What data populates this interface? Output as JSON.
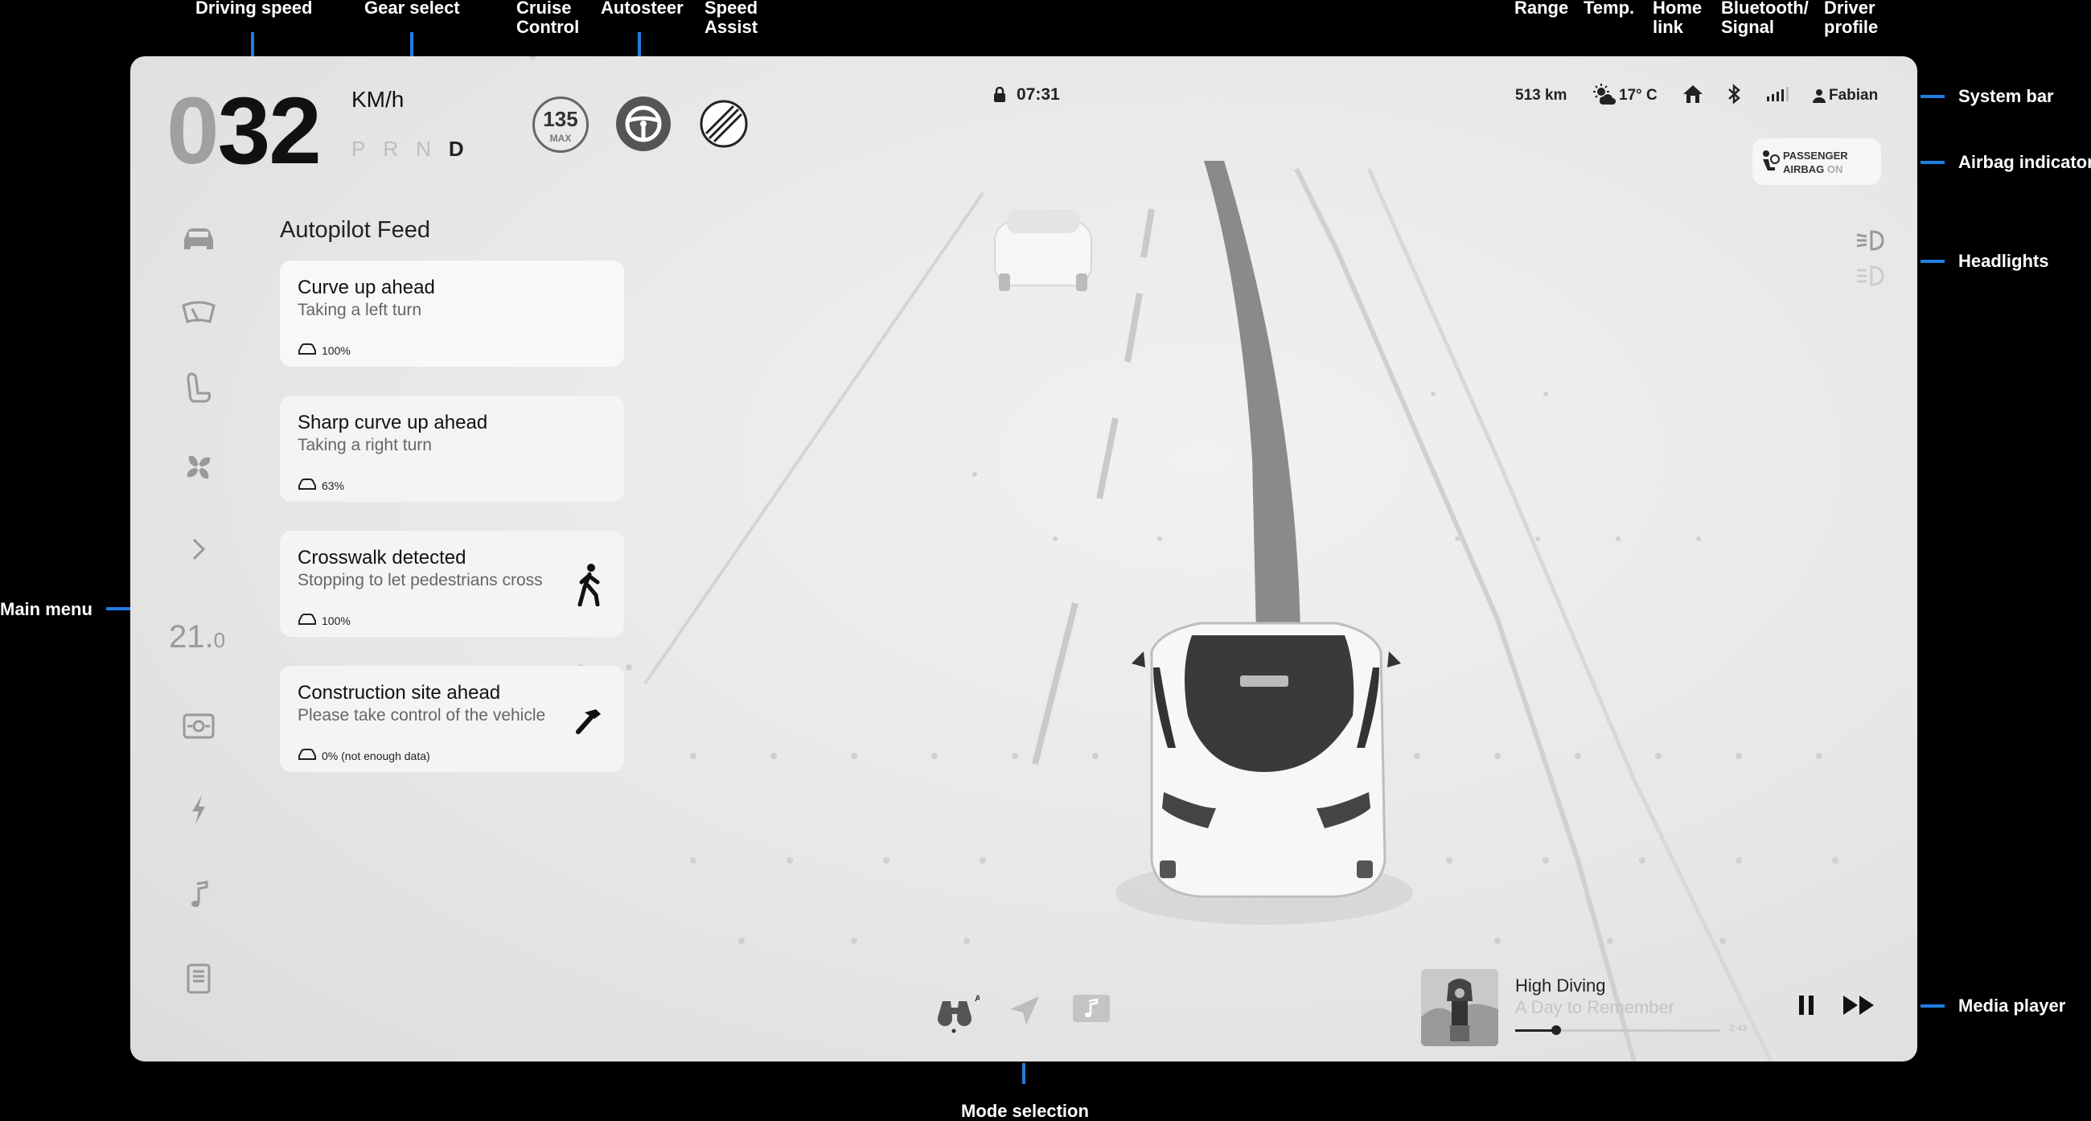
{
  "annotations": {
    "top": [
      "Driving speed",
      "Gear select",
      "Cruise\nControl",
      "Autosteer",
      "Speed\nAssist",
      "Range",
      "Temp.",
      "Home\nlink",
      "Bluetooth/\nSignal",
      "Driver\nprofile"
    ],
    "right": [
      "System bar",
      "Airbag indicator",
      "Headlights",
      "Media player"
    ],
    "left": [
      "Main menu"
    ],
    "bottom": [
      "Mode selection"
    ]
  },
  "speed": {
    "lead": "0",
    "value": "32",
    "unit": "KM/h"
  },
  "gears": [
    "P",
    "R",
    "N",
    "D"
  ],
  "active_gear": "D",
  "cruise": {
    "value": "135",
    "label": "MAX"
  },
  "clock": "07:31",
  "system_bar": {
    "range": "513 km",
    "temperature": "17° C",
    "driver": "Fabian"
  },
  "airbag": {
    "line1": "PASSENGER",
    "line2": "AIRBAG",
    "state": "ON"
  },
  "main_menu": {
    "items": [
      "car-icon",
      "wiper-icon",
      "seat-icon",
      "fan-icon",
      "chevron-right-icon",
      "defrost-icon",
      "lightning-icon",
      "music-icon",
      "manual-icon"
    ],
    "temperature": {
      "whole": "21.",
      "decimal": "0"
    }
  },
  "feed": {
    "title": "Autopilot Feed",
    "cards": [
      {
        "heading": "Curve up ahead",
        "sub": "Taking a left turn",
        "confidence": "100%",
        "icon": ""
      },
      {
        "heading": "Sharp curve up ahead",
        "sub": "Taking a right turn",
        "confidence": "63%",
        "icon": ""
      },
      {
        "heading": "Crosswalk detected",
        "sub": "Stopping to let pedestrians cross",
        "confidence": "100%",
        "icon": "pedestrian-icon"
      },
      {
        "heading": "Construction site ahead",
        "sub": "Please take control of the vehicle",
        "confidence": "0% (not enough data)",
        "icon": "hammer-icon"
      }
    ]
  },
  "modes": {
    "items": [
      "binoculars-icon",
      "navigate-icon",
      "media-icon"
    ],
    "binoculars_badge": "A"
  },
  "media": {
    "title": "High Diving",
    "artist": "A Day to Remember",
    "time": "-2:43",
    "progress": 0.2
  },
  "colors": {
    "accent": "#1e7fe0",
    "screen_bg": "#e7e7e7",
    "card_bg": "#f4f4f4"
  }
}
